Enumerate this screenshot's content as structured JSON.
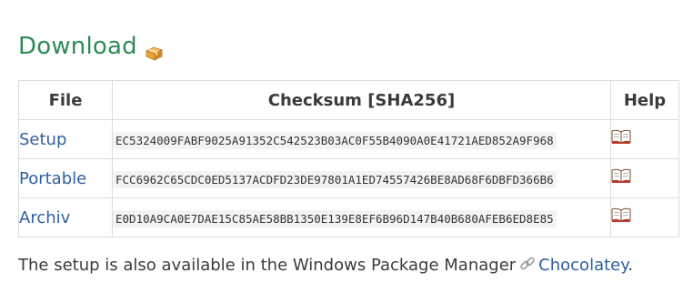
{
  "section": {
    "title": "Download",
    "icon": "package-icon"
  },
  "table": {
    "headers": {
      "file": "File",
      "checksum": "Checksum [SHA256]",
      "help": "Help"
    },
    "rows": [
      {
        "file": "Setup",
        "checksum": "EC5324009FABF9025A91352C542523B03AC0F55B4090A0E41721AED852A9F968",
        "help_icon": "book-icon"
      },
      {
        "file": "Portable",
        "checksum": "FCC6962C65CDC0ED5137ACDFD23DE97801A1ED74557426BE8AD68F6DBFD366B6",
        "help_icon": "book-icon"
      },
      {
        "file": "Archiv",
        "checksum": "E0D10A9CA0E7DAE15C85AE58BB1350E139E8EF6B96D147B40B680AFEB6ED8E85",
        "help_icon": "book-icon"
      }
    ]
  },
  "footer": {
    "text": "The setup is also available in the Windows Package Manager",
    "link_icon": "link-icon",
    "link_label": "Chocolatey",
    "trailing": "."
  },
  "colors": {
    "heading": "#2e8b57",
    "link": "#2f5f9f",
    "border": "#dcdcdc"
  }
}
